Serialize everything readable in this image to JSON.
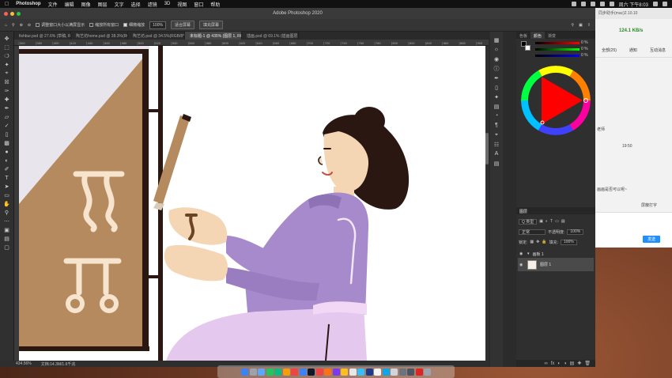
{
  "menubar": {
    "apple": "",
    "app": "Photoshop",
    "items": [
      "文件",
      "编辑",
      "图像",
      "图层",
      "文字",
      "选择",
      "滤镜",
      "3D",
      "视图",
      "窗口",
      "帮助"
    ],
    "clock": "周六 下午8:03"
  },
  "window": {
    "title": "Adobe Photoshop 2020"
  },
  "options": {
    "check1": "调整窗口大小以满屏显示",
    "check2": "缩放所有窗口",
    "check3": "细微缩放",
    "zoom_field": "100%",
    "btn_fit": "适合屏幕",
    "btn_fill": "填充屏幕"
  },
  "tabs": [
    {
      "label": "fishbur.psd @ 27.6% (草稿, RGB/8)"
    },
    {
      "label": "陶艺坊home.psd @ 38.3%(RGB/8)"
    },
    {
      "label": "陶艺坊.psd @ 34.5%(RGB/8*)"
    },
    {
      "label": "未标题-1 @ 435% (图层 1, RGB/8#) *"
    },
    {
      "label": "插画.psd @ 69.1% (插画图层, RGB/8)"
    }
  ],
  "ruler": {
    "ticks": [
      "360",
      "380",
      "400",
      "420",
      "440",
      "460",
      "480",
      "500",
      "520",
      "540",
      "560",
      "580",
      "600",
      "620",
      "640",
      "660",
      "680",
      "700",
      "720",
      "740",
      "760",
      "780",
      "800",
      "820",
      "840",
      "860",
      "880",
      "900"
    ]
  },
  "status": {
    "zoom": "434.56%",
    "doc": "文档:14.3M/1.6千兆"
  },
  "color_panel": {
    "tabs": [
      "色板",
      "颜色",
      "渐变"
    ],
    "values": [
      "0",
      "0",
      "0"
    ],
    "units": [
      "%",
      "%",
      "%"
    ],
    "accent": "#ff0000"
  },
  "layers_panel": {
    "title": "图层",
    "kind": "Q 类型",
    "blend": "正常",
    "opacity_label": "不透明度:",
    "opacity": "100%",
    "lock_label": "锁定:",
    "fill_label": "填充:",
    "fill": "100%",
    "group": "画板 1",
    "layer": "图层 1"
  },
  "chat": {
    "top": "同步助手(mac)2.10.10",
    "speed": "124.1 KB/s",
    "tabs": [
      "全部(25)",
      "通知",
      "互动消息"
    ],
    "time": "19:50",
    "snippets": [
      "老师",
      "画画是否可以呢~"
    ],
    "checkbox": "屏蔽打字",
    "send": "发送"
  },
  "colors": {
    "ps_bg": "#2b2b2b",
    "canvas": "#ffffff",
    "frame_brown": "#b58a5e",
    "glyph": "#f6e4cf",
    "sleeve": "#a78acb",
    "hair": "#2a1712",
    "skin": "#f4d6b4"
  }
}
